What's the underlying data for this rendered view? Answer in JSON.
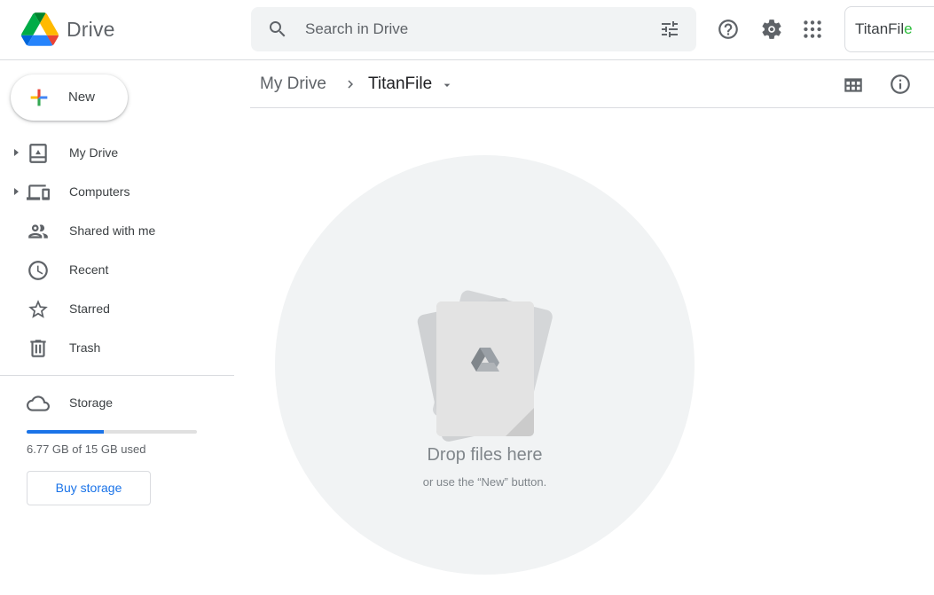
{
  "app": {
    "product_name": "Drive"
  },
  "search": {
    "placeholder": "Search in Drive"
  },
  "brand": {
    "text_main": "TitanFil",
    "text_accent": "e",
    "accent_color": "#2dbe3c"
  },
  "sidebar": {
    "new_label": "New",
    "items": [
      {
        "label": "My Drive",
        "icon": "my-drive-icon",
        "expandable": true
      },
      {
        "label": "Computers",
        "icon": "computers-icon",
        "expandable": true
      },
      {
        "label": "Shared with me",
        "icon": "shared-icon",
        "expandable": false
      },
      {
        "label": "Recent",
        "icon": "clock-icon",
        "expandable": false
      },
      {
        "label": "Starred",
        "icon": "star-icon",
        "expandable": false
      },
      {
        "label": "Trash",
        "icon": "trash-icon",
        "expandable": false
      }
    ],
    "storage": {
      "label": "Storage",
      "usage_text": "6.77 GB of 15 GB used",
      "used_fraction": 0.451,
      "bar_color": "#1a73e8",
      "buy_label": "Buy storage"
    }
  },
  "breadcrumb": {
    "root": "My Drive",
    "current": "TitanFile"
  },
  "empty_state": {
    "title": "Drop files here",
    "subtitle": "or use the “New” button."
  },
  "colors": {
    "accent": "#1a73e8",
    "text_secondary": "#5f6368",
    "divider": "#dadce0",
    "search_bg": "#f1f3f4"
  }
}
